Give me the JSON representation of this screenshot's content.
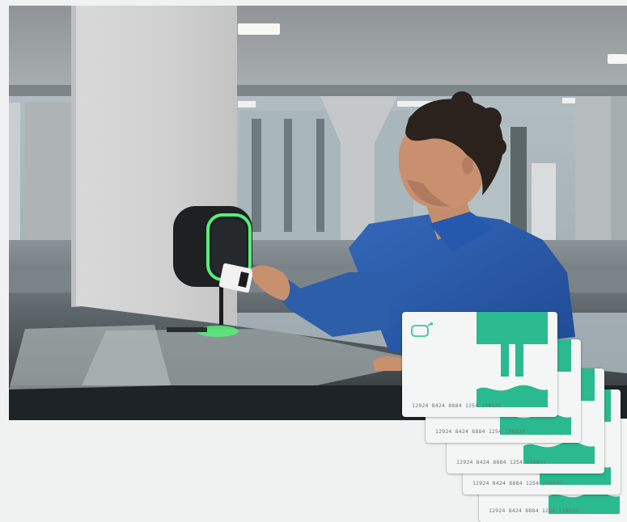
{
  "scene": {
    "description_alt": "",
    "colors": {
      "brand_green": "#2bb98f",
      "shirt_blue": "#2a58a8",
      "charger_black": "#1e2022",
      "glow": "#53f079"
    }
  },
  "cards": [
    {
      "number": "12924 8424 8884 1254 158835",
      "icon": "contactless-icon",
      "logo": "brand-logo-icon"
    },
    {
      "number": "12924 8424 8884 1254 158835",
      "icon": "contactless-icon",
      "logo": "brand-logo-icon"
    },
    {
      "number": "12924 8424 8884 1254 158835",
      "icon": "contactless-icon",
      "logo": "brand-logo-icon"
    },
    {
      "number": "12924 8424 8884 1254 158835",
      "icon": "contactless-icon",
      "logo": "brand-logo-icon"
    },
    {
      "number": "12924 8424 8884 1254 158835",
      "icon": "contactless-icon",
      "logo": "brand-logo-icon"
    }
  ]
}
